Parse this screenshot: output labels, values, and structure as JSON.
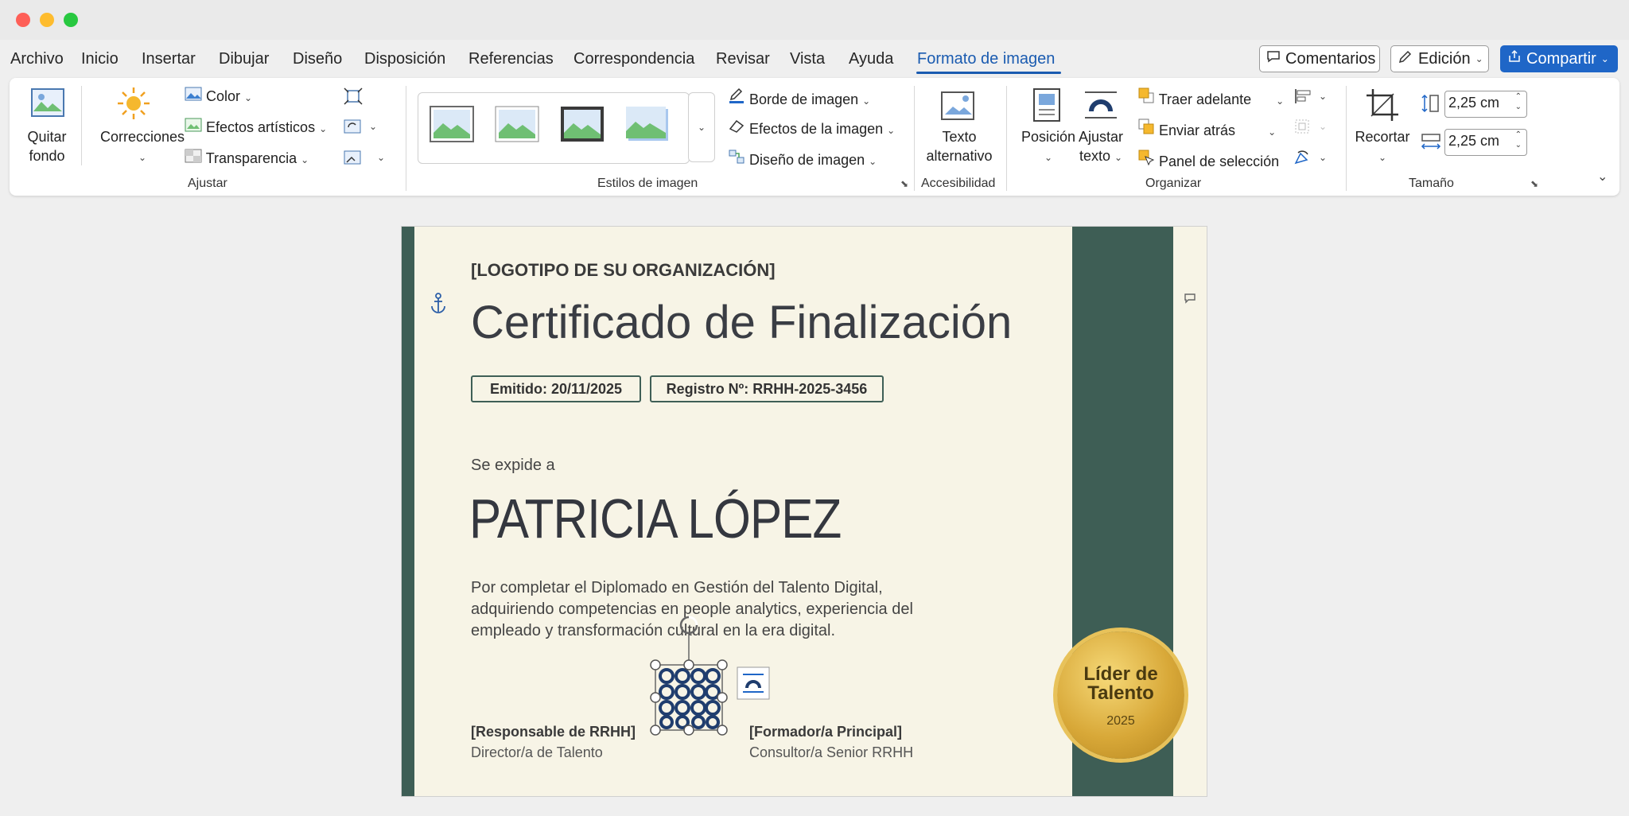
{
  "menu": {
    "tabs": [
      "Archivo",
      "Inicio",
      "Insertar",
      "Dibujar",
      "Diseño",
      "Disposición",
      "Referencias",
      "Correspondencia",
      "Revisar",
      "Vista",
      "Ayuda",
      "Formato de imagen"
    ],
    "active_tab": "Formato de imagen",
    "comments_label": "Comentarios",
    "editing_label": "Edición",
    "share_label": "Compartir"
  },
  "ribbon": {
    "ajustar": {
      "remove_bg_line1": "Quitar",
      "remove_bg_line2": "fondo",
      "corrections_label": "Correcciones",
      "color_label": "Color",
      "artistic_label": "Efectos artísticos",
      "transparency_label": "Transparencia",
      "group_label": "Ajustar"
    },
    "styles": {
      "border_label": "Borde de imagen",
      "effects_label": "Efectos de la imagen",
      "layout_label": "Diseño de imagen",
      "group_label": "Estilos de imagen"
    },
    "accessibility": {
      "alt_line1": "Texto",
      "alt_line2": "alternativo",
      "group_label": "Accesibilidad"
    },
    "organize": {
      "position_label": "Posición",
      "wrap_line1": "Ajustar",
      "wrap_line2": "texto",
      "bring_forward_label": "Traer adelante",
      "send_backward_label": "Enviar atrás",
      "selection_pane_label": "Panel de selección",
      "group_label": "Organizar"
    },
    "size": {
      "crop_label": "Recortar",
      "height_value": "2,25 cm",
      "width_value": "2,25 cm",
      "group_label": "Tamaño"
    }
  },
  "certificate": {
    "logo_placeholder": "[LOGOTIPO DE SU ORGANIZACIÓN]",
    "title": "Certificado de Finalización",
    "issued": "Emitido: 20/11/2025",
    "registry": "Registro Nº: RRHH-2025-3456",
    "issued_to": "Se expide a",
    "recipient": "PATRICIA LÓPEZ",
    "body_line1": "Por completar el Diplomado en Gestión del Talento Digital,",
    "body_line2": "adquiriendo competencias en people analytics, experiencia del",
    "body_line3": "empleado y transformación cultural en la era digital.",
    "sig1_title": "[Responsable de RRHH]",
    "sig1_role": "Director/a de Talento",
    "sig2_title": "[Formador/a Principal]",
    "sig2_role": "Consultor/a Senior RRHH",
    "badge_line1": "Líder de",
    "badge_line2": "Talento",
    "badge_year": "2025"
  },
  "colors": {
    "accent_blue": "#1a5bb0",
    "share_blue": "#1f66c7",
    "sidebar_green": "#3e5e55",
    "page_cream": "#f7f4e6",
    "badge_gold": "#d8a838"
  }
}
